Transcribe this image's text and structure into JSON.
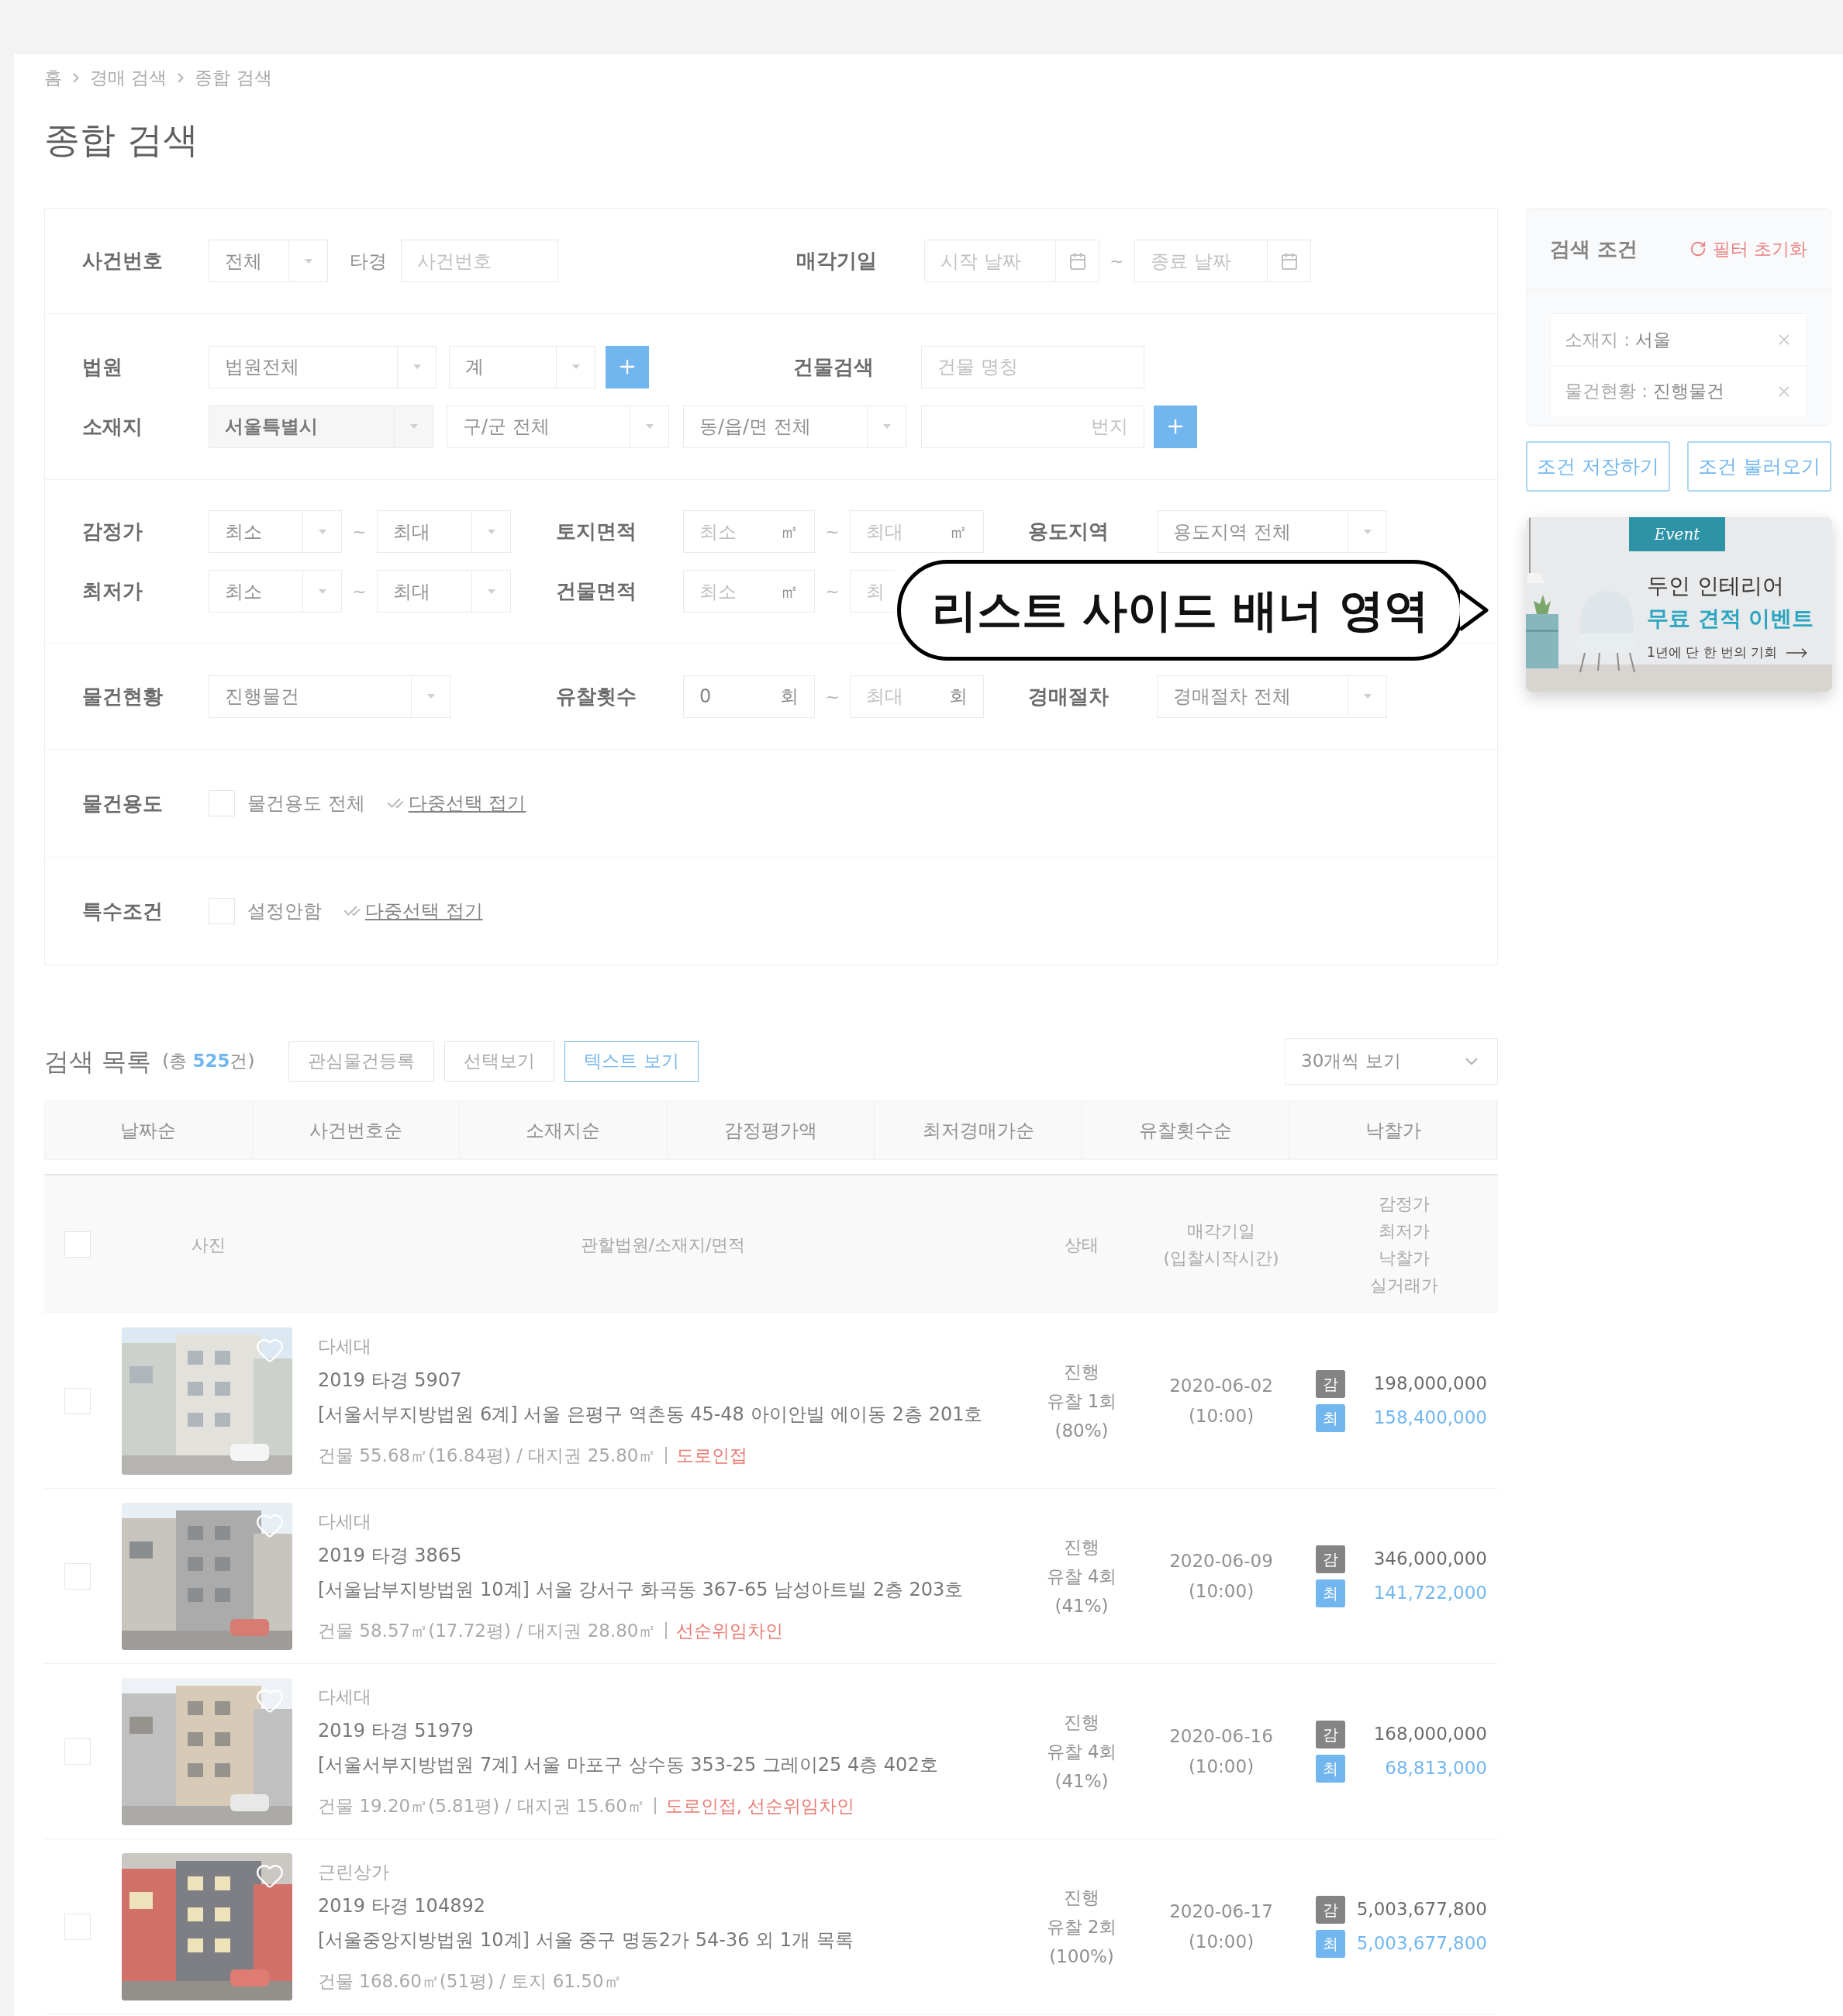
{
  "breadcrumb": [
    "홈",
    "경매 검색",
    "종합 검색"
  ],
  "page_title": "종합 검색",
  "filters": {
    "case": {
      "label": "사건번호",
      "select": "전체",
      "court_type": "타경",
      "placeholder": "사건번호"
    },
    "sale_date": {
      "label": "매각기일",
      "start_placeholder": "시작 날짜",
      "separator": "~",
      "end_placeholder": "종료 날짜"
    },
    "court": {
      "label": "법원",
      "select": "법원전체",
      "division": "계"
    },
    "building": {
      "label": "건물검색",
      "placeholder": "건물 명칭"
    },
    "location": {
      "label": "소재지",
      "city": "서울특별시",
      "district": "구/군 전체",
      "town": "동/읍/면 전체",
      "lot_placeholder": "번지"
    },
    "appraisal_price": {
      "label": "감정가",
      "kind": "select",
      "min": "최소",
      "separator": "~",
      "max": "최대"
    },
    "land_area": {
      "label": "토지면적",
      "kind": "input",
      "min_placeholder": "최소",
      "min_unit": "㎡",
      "separator": "~",
      "max_placeholder": "최대",
      "max_unit": "㎡"
    },
    "zoning": {
      "label": "용도지역",
      "select": "용도지역 전체"
    },
    "minimum_price": {
      "label": "최저가",
      "kind": "select",
      "min": "최소",
      "separator": "~",
      "max": "최대"
    },
    "building_area": {
      "label": "건물면적",
      "kind": "input",
      "min_placeholder": "최소",
      "min_unit": "㎡",
      "separator": "~",
      "max_placeholder": "최"
    },
    "status": {
      "label": "물건현황",
      "select": "진행물건"
    },
    "failed_bids": {
      "label": "유찰횟수",
      "kind": "input",
      "min_value": "0",
      "min_unit": "회",
      "separator": "~",
      "max_placeholder": "최대",
      "max_unit": "회"
    },
    "procedure": {
      "label": "경매절차",
      "select": "경매절차 전체"
    },
    "usage": {
      "label": "물건용도",
      "checked": false,
      "option": "물건용도 전체",
      "link": "다중선택 접기"
    },
    "special": {
      "label": "특수조건",
      "checked": false,
      "option": "설정안함",
      "link": "다중선택 접기"
    }
  },
  "conditions": {
    "title": "검색 조건",
    "reset": "필터 초기화",
    "chips": [
      {
        "name": "소재지 :",
        "value": "서울"
      },
      {
        "name": "물건현황 :",
        "value": "진행물건"
      }
    ]
  },
  "condition_buttons": [
    "조건 저장하기",
    "조건 불러오기"
  ],
  "banner": {
    "tag": "Event",
    "title": "두인 인테리어",
    "highlight": "무료 견적 이벤트",
    "subtitle": "1년에 단 한 번의 기회"
  },
  "callout": "리스트 사이드 배너 영역",
  "results": {
    "title": "검색 목록",
    "total_prefix": "(총",
    "count": "525",
    "total_suffix": "건)",
    "page_size": "30개씩 보기",
    "actions": [
      {
        "label": "관심물건등록",
        "selected": false
      },
      {
        "label": "선택보기",
        "selected": false
      },
      {
        "label": "텍스트 보기",
        "selected": true
      }
    ]
  },
  "sort_tabs": [
    "날짜순",
    "사건번호순",
    "소재지순",
    "감정평가액",
    "최저경매가순",
    "유찰횟수순",
    "낙찰가"
  ],
  "table": {
    "select_all_checked": false,
    "columns": [
      [
        "사진"
      ],
      [
        "관할법원/소재지/면적"
      ],
      [
        "상태"
      ],
      [
        "매각기일",
        "(입찰시작시간)"
      ],
      [
        "감정가",
        "최저가",
        "낙찰가",
        "실거래가"
      ]
    ],
    "rows": [
      {
        "checked": false,
        "type": "다세대",
        "case": "2019 타경 5907",
        "address": "[서울서부지방법원 6계] 서울 은평구 역촌동 45-48 아이안빌 에이동 2층 201호",
        "area": "건물 55.68㎡(16.84평) / 대지권 25.80㎡",
        "tags": "도로인접",
        "status": "진행",
        "failed": "유찰 1회",
        "ratio": "(80%)",
        "date": "2020-06-02",
        "time": "(10:00)",
        "appraisal_badge": "감",
        "appraisal": "198,000,000",
        "minimum_badge": "최",
        "minimum": "158,400,000"
      },
      {
        "checked": false,
        "type": "다세대",
        "case": "2019 타경 3865",
        "address": "[서울남부지방법원 10계] 서울 강서구 화곡동 367-65 남성아트빌 2층 203호",
        "area": "건물 58.57㎡(17.72평) / 대지권 28.80㎡",
        "tags": "선순위임차인",
        "status": "진행",
        "failed": "유찰 4회",
        "ratio": "(41%)",
        "date": "2020-06-09",
        "time": "(10:00)",
        "appraisal_badge": "감",
        "appraisal": "346,000,000",
        "minimum_badge": "최",
        "minimum": "141,722,000"
      },
      {
        "checked": false,
        "type": "다세대",
        "case": "2019 타경 51979",
        "address": "[서울서부지방법원 7계] 서울 마포구 상수동 353-25 그레이25 4층 402호",
        "area": "건물 19.20㎡(5.81평) / 대지권 15.60㎡",
        "tags": "도로인접, 선순위임차인",
        "status": "진행",
        "failed": "유찰 4회",
        "ratio": "(41%)",
        "date": "2020-06-16",
        "time": "(10:00)",
        "appraisal_badge": "감",
        "appraisal": "168,000,000",
        "minimum_badge": "최",
        "minimum": "68,813,000"
      },
      {
        "checked": false,
        "type": "근린상가",
        "case": "2019 타경 104892",
        "address": "[서울중앙지방법원 10계] 서울 중구 명동2가 54-36 외 1개 목록",
        "area": "건물 168.60㎡(51평) / 토지 61.50㎡",
        "status": "진행",
        "failed": "유찰 2회",
        "ratio": "(100%)",
        "date": "2020-06-17",
        "time": "(10:00)",
        "appraisal_badge": "감",
        "appraisal": "5,003,677,800",
        "minimum_badge": "최",
        "minimum": "5,003,677,800"
      }
    ]
  }
}
